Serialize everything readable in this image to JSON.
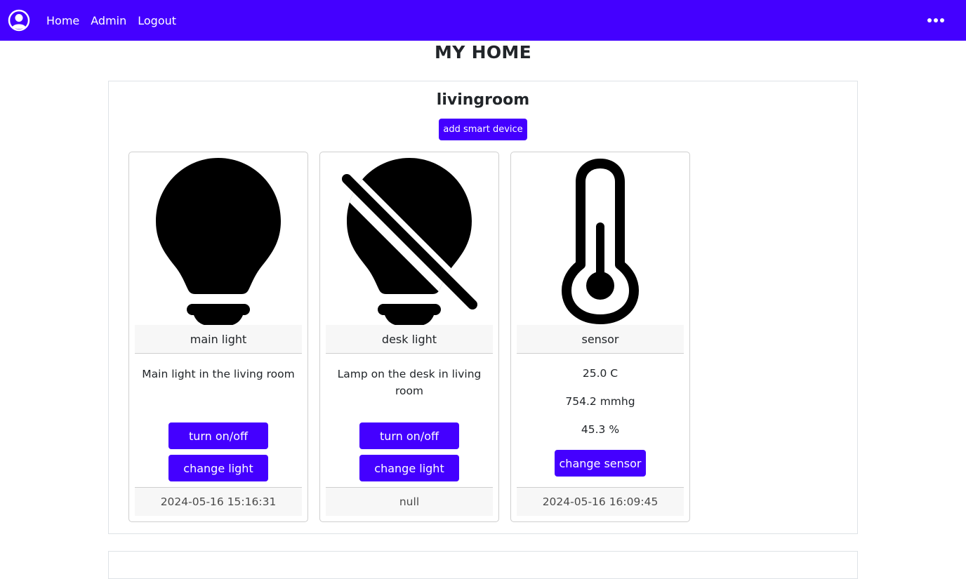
{
  "nav": {
    "links": [
      "Home",
      "Admin",
      "Logout"
    ],
    "avatar_icon": "user-circle-icon",
    "more_icon": "more-horizontal-icon",
    "bg_color": "#4400ff"
  },
  "page": {
    "title": "MY HOME"
  },
  "room": {
    "name": "livingroom",
    "add_device_label": "add smart device",
    "devices": [
      {
        "icon": "lightbulb-icon",
        "name": "main light",
        "description": "Main light in the living room",
        "buttons": [
          "turn on/off",
          "change light"
        ],
        "footer": "2024-05-16 15:16:31"
      },
      {
        "icon": "lightbulb-off-icon",
        "name": "desk light",
        "description": "Lamp on the desk in living room",
        "buttons": [
          "turn on/off",
          "change light"
        ],
        "footer": "null"
      },
      {
        "icon": "thermometer-icon",
        "name": "sensor",
        "values": [
          "25.0 C",
          "754.2 mmhg",
          "45.3 %"
        ],
        "buttons": [
          "change sensor"
        ],
        "footer": "2024-05-16 16:09:45"
      }
    ]
  }
}
